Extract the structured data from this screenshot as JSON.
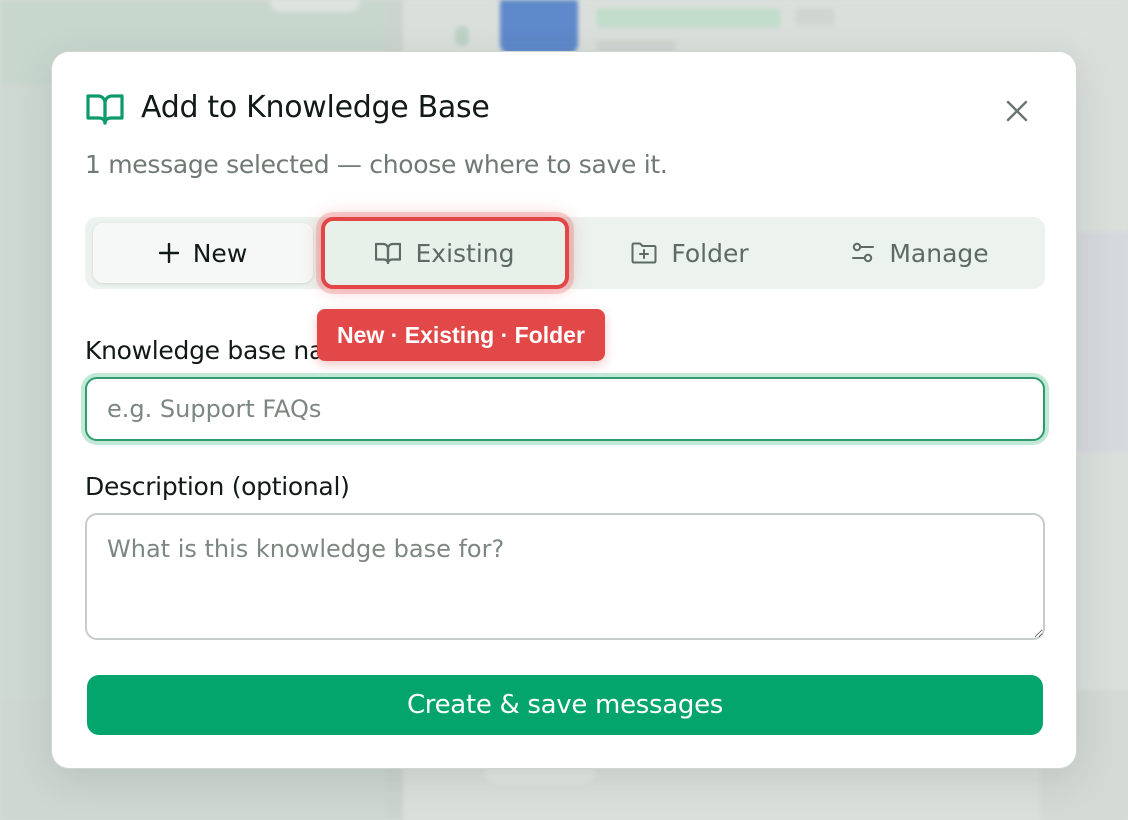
{
  "modal": {
    "title": "Add to Knowledge Base",
    "subtitle": "1 message selected — choose where to save it.",
    "accent_color": "#04a56d"
  },
  "tabs": [
    {
      "label": "New",
      "icon": "plus-icon",
      "active": true
    },
    {
      "label": "Existing",
      "icon": "book-icon",
      "highlighted": true
    },
    {
      "label": "Folder",
      "icon": "folder-plus-icon"
    },
    {
      "label": "Manage",
      "icon": "sliders-icon"
    }
  ],
  "tooltip": {
    "text": "New · Existing · Folder",
    "color": "#e24848"
  },
  "form": {
    "name_label": "Knowledge base name",
    "name_placeholder": "e.g. Support FAQs",
    "name_value": "",
    "description_label": "Description (optional)",
    "description_placeholder": "What is this knowledge base for?",
    "description_value": "",
    "submit_label": "Create & save messages"
  }
}
